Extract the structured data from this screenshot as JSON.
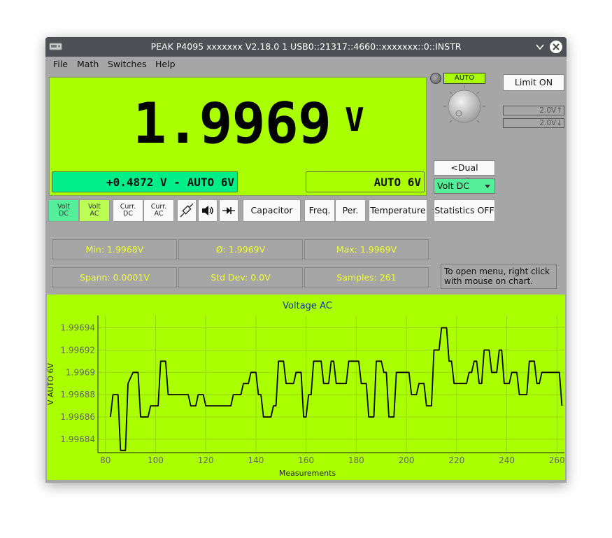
{
  "window": {
    "title": "PEAK P4095 xxxxxxx V2.18.0 1 USB0::21317::4660::xxxxxxx::0::INSTR"
  },
  "menu": [
    "File",
    "Math",
    "Switches",
    "Help"
  ],
  "display": {
    "value": "1.9969",
    "unit": "V",
    "secondary": "+0.4872 V - AUTO 6V",
    "range": "AUTO 6V",
    "background_color": "#aaff00"
  },
  "controls": {
    "auto_badge": "AUTO",
    "limit_button": "Limit ON",
    "limit_upper": "2.0V↑",
    "limit_lower": "2.0V↓",
    "dual_toggle": "<Dual toggle>",
    "mode_select": "Volt DC",
    "statistics_button": "Statistics OFF"
  },
  "mode_buttons": {
    "volt_dc": [
      "Volt",
      "DC"
    ],
    "volt_ac": [
      "Volt",
      "AC"
    ],
    "curr_dc": [
      "Curr.",
      "DC"
    ],
    "curr_ac": [
      "Curr.",
      "AC"
    ],
    "capacitor": "Capacitor",
    "freq": "Freq.",
    "per": "Per.",
    "temperature": "Temperature",
    "icons": [
      "resistor-icon",
      "speaker-icon",
      "diode-icon"
    ]
  },
  "stats": {
    "min": "Min: 1.9968V",
    "avg": "Ø: 1.9969V",
    "max": "Max: 1.9969V",
    "span": "Spann: 0.0001V",
    "stddev": "Std Dev: 0.0V",
    "samples": "Samples: 261"
  },
  "hint": "To open menu, right click with mouse on chart.",
  "chart_data": {
    "type": "line",
    "title": "Voltage AC",
    "xlabel": "Measurements",
    "ylabel": "V AUTO 6V",
    "xlim": [
      77,
      263
    ],
    "ylim": [
      1.996828,
      1.996951
    ],
    "x_ticks": [
      80,
      100,
      120,
      140,
      160,
      180,
      200,
      220,
      240,
      260
    ],
    "y_ticks": [
      "1.99694",
      "1.99692",
      "1.9969",
      "1.99688",
      "1.99686",
      "1.99684"
    ],
    "y_tick_values": [
      1.99694,
      1.99692,
      1.9969,
      1.99688,
      1.99686,
      1.99684
    ],
    "grid": true,
    "series": [
      {
        "color": "#000000",
        "points": [
          [
            82,
            1.99686
          ],
          [
            83,
            1.99688
          ],
          [
            85,
            1.99688
          ],
          [
            86,
            1.99683
          ],
          [
            88,
            1.99683
          ],
          [
            89,
            1.99689
          ],
          [
            91,
            1.9969
          ],
          [
            93,
            1.9969
          ],
          [
            94,
            1.99686
          ],
          [
            97,
            1.99686
          ],
          [
            98,
            1.99687
          ],
          [
            101,
            1.99687
          ],
          [
            102,
            1.99691
          ],
          [
            104,
            1.99691
          ],
          [
            105,
            1.99688
          ],
          [
            108,
            1.99688
          ],
          [
            109,
            1.99688
          ],
          [
            110,
            1.99688
          ],
          [
            111,
            1.99688
          ],
          [
            113,
            1.99688
          ],
          [
            114,
            1.99687
          ],
          [
            116,
            1.99687
          ],
          [
            117,
            1.99688
          ],
          [
            119,
            1.99688
          ],
          [
            120,
            1.99687
          ],
          [
            123,
            1.99687
          ],
          [
            124,
            1.99687
          ],
          [
            127,
            1.99687
          ],
          [
            128,
            1.99687
          ],
          [
            130,
            1.99687
          ],
          [
            131,
            1.99688
          ],
          [
            134,
            1.99688
          ],
          [
            135,
            1.99689
          ],
          [
            137,
            1.99689
          ],
          [
            138,
            1.9969
          ],
          [
            140,
            1.9969
          ],
          [
            141,
            1.99688
          ],
          [
            142,
            1.99688
          ],
          [
            143,
            1.99686
          ],
          [
            146,
            1.99686
          ],
          [
            147,
            1.99687
          ],
          [
            148,
            1.99687
          ],
          [
            149,
            1.99691
          ],
          [
            151,
            1.99691
          ],
          [
            152,
            1.99689
          ],
          [
            155,
            1.99689
          ],
          [
            156,
            1.9969
          ],
          [
            158,
            1.9969
          ],
          [
            159,
            1.99686
          ],
          [
            160,
            1.99686
          ],
          [
            161,
            1.99688
          ],
          [
            162,
            1.99688
          ],
          [
            163,
            1.99691
          ],
          [
            166,
            1.99691
          ],
          [
            167,
            1.99689
          ],
          [
            169,
            1.99689
          ],
          [
            170,
            1.99691
          ],
          [
            171,
            1.99691
          ],
          [
            172,
            1.99689
          ],
          [
            174,
            1.99689
          ],
          [
            175,
            1.99689
          ],
          [
            176,
            1.99689
          ],
          [
            177,
            1.99691
          ],
          [
            181,
            1.99691
          ],
          [
            182,
            1.99689
          ],
          [
            184,
            1.99689
          ],
          [
            185,
            1.99686
          ],
          [
            187,
            1.99686
          ],
          [
            188,
            1.99691
          ],
          [
            190,
            1.99691
          ],
          [
            191,
            1.9969
          ],
          [
            192,
            1.9969
          ],
          [
            193,
            1.99686
          ],
          [
            195,
            1.99686
          ],
          [
            196,
            1.9969
          ],
          [
            199,
            1.9969
          ],
          [
            200,
            1.9969
          ],
          [
            201,
            1.9969
          ],
          [
            202,
            1.99688
          ],
          [
            204,
            1.99688
          ],
          [
            205,
            1.99689
          ],
          [
            207,
            1.99689
          ],
          [
            208,
            1.99687
          ],
          [
            210,
            1.99687
          ],
          [
            211,
            1.99692
          ],
          [
            213,
            1.99692
          ],
          [
            214,
            1.99694
          ],
          [
            216,
            1.99694
          ],
          [
            217,
            1.99691
          ],
          [
            218,
            1.99691
          ],
          [
            219,
            1.99689
          ],
          [
            220,
            1.99689
          ],
          [
            221,
            1.99689
          ],
          [
            224,
            1.99689
          ],
          [
            225,
            1.9969
          ],
          [
            226,
            1.9969
          ],
          [
            227,
            1.99691
          ],
          [
            228,
            1.99691
          ],
          [
            229,
            1.99689
          ],
          [
            230,
            1.99689
          ],
          [
            231,
            1.99692
          ],
          [
            233,
            1.99692
          ],
          [
            234,
            1.9969
          ],
          [
            236,
            1.9969
          ],
          [
            237,
            1.99692
          ],
          [
            238,
            1.99692
          ],
          [
            239,
            1.99689
          ],
          [
            241,
            1.99689
          ],
          [
            242,
            1.9969
          ],
          [
            244,
            1.9969
          ],
          [
            245,
            1.99688
          ],
          [
            248,
            1.99688
          ],
          [
            249,
            1.99691
          ],
          [
            251,
            1.99691
          ],
          [
            252,
            1.99689
          ],
          [
            253,
            1.99689
          ],
          [
            254,
            1.9969
          ],
          [
            256,
            1.9969
          ],
          [
            261,
            1.9969
          ],
          [
            262,
            1.99687
          ]
        ]
      }
    ]
  }
}
